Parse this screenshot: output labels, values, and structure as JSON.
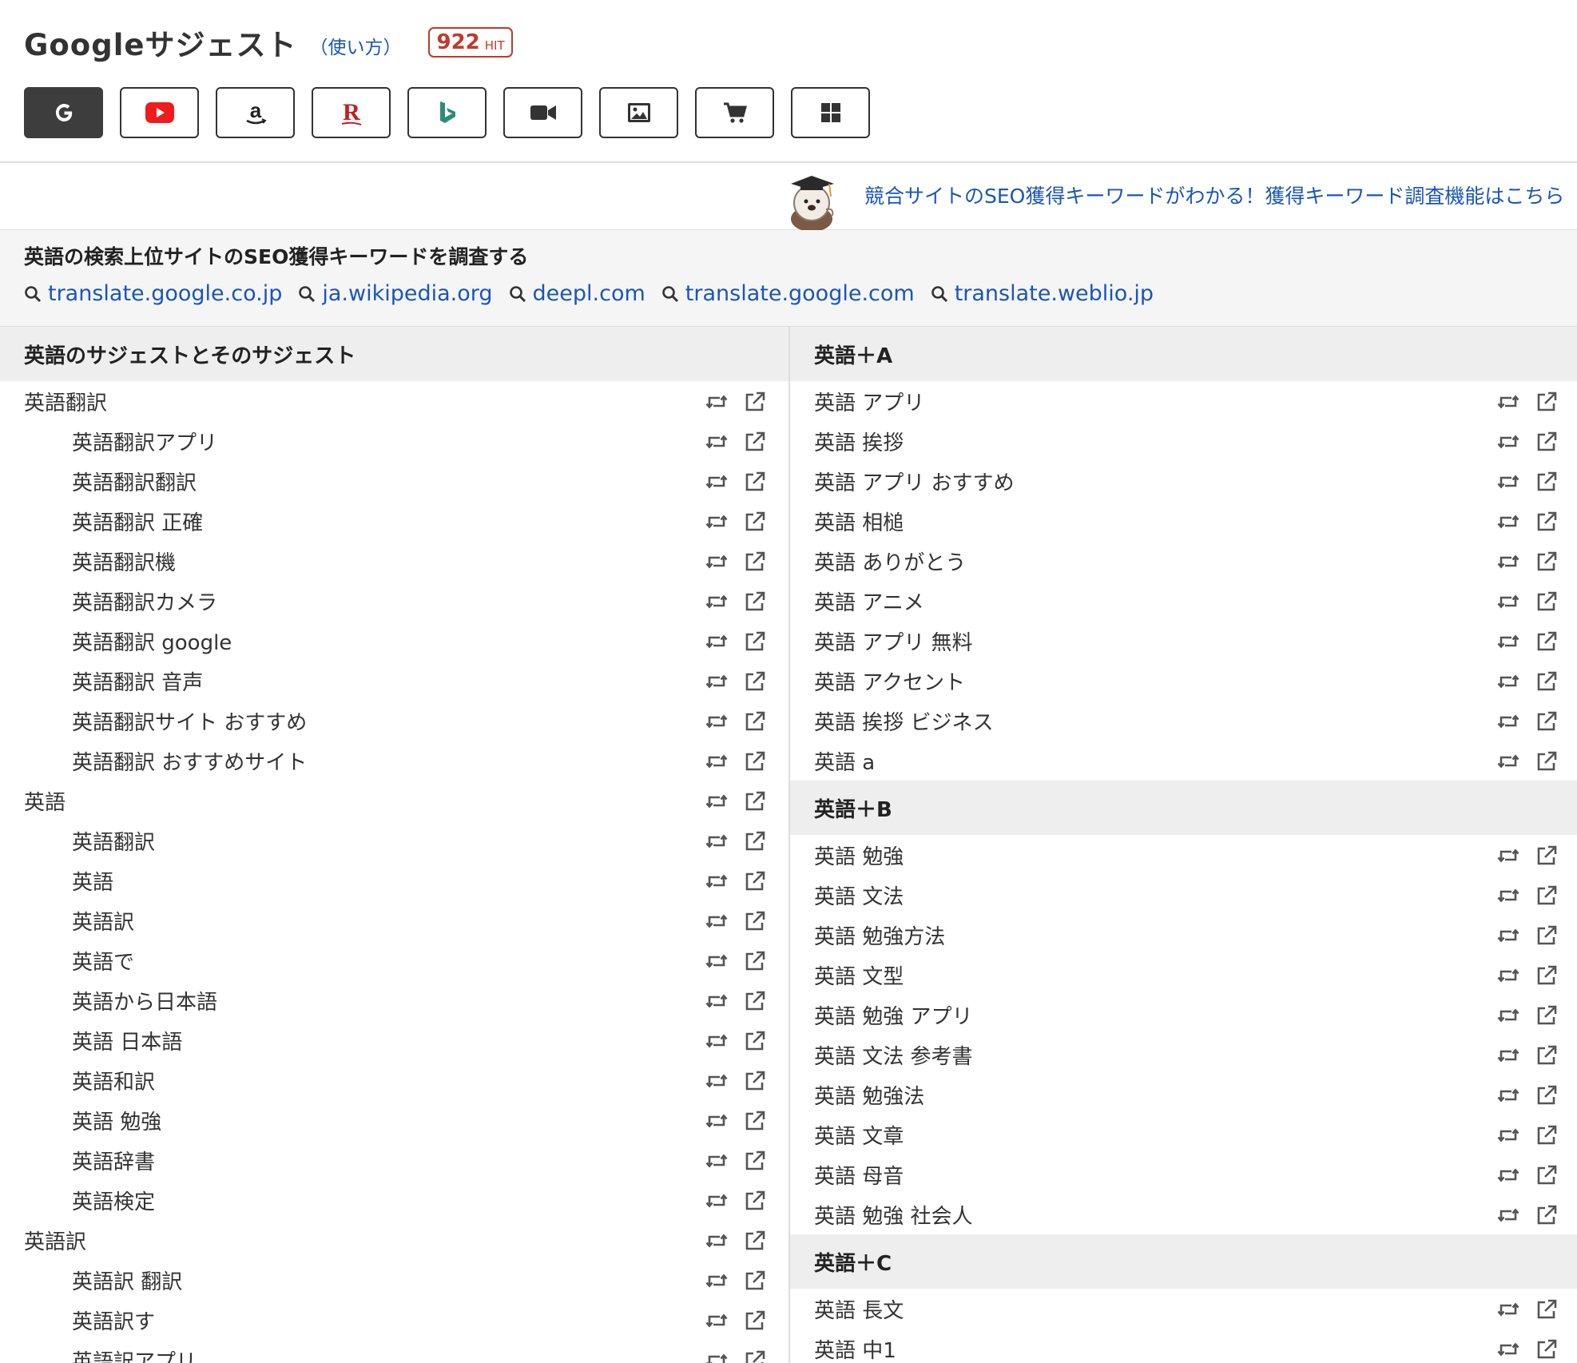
{
  "header": {
    "title": "Googleサジェスト",
    "howto": "（使い方）",
    "hit_count": "922",
    "hit_label": "HIT",
    "engines": [
      "google-icon",
      "youtube-icon",
      "amazon-icon",
      "rakuten-icon",
      "bing-icon",
      "video-icon",
      "image-icon",
      "cart-icon",
      "windows-icon"
    ],
    "active_engine": "google-icon"
  },
  "promo": {
    "text": "競合サイトのSEO獲得キーワードがわかる！獲得キーワード調査機能はこちら"
  },
  "seo": {
    "title": "英語の検索上位サイトのSEO獲得キーワードを調査する",
    "sites": [
      "translate.google.co.jp",
      "ja.wikipedia.org",
      "deepl.com",
      "translate.google.com",
      "translate.weblio.jp"
    ]
  },
  "left": {
    "header": "英語のサジェストとそのサジェスト",
    "rows": [
      {
        "text": "英語翻訳",
        "level": "parent"
      },
      {
        "text": "英語翻訳アプリ",
        "level": "child"
      },
      {
        "text": "英語翻訳翻訳",
        "level": "child"
      },
      {
        "text": "英語翻訳 正確",
        "level": "child"
      },
      {
        "text": "英語翻訳機",
        "level": "child"
      },
      {
        "text": "英語翻訳カメラ",
        "level": "child"
      },
      {
        "text": "英語翻訳 google",
        "level": "child"
      },
      {
        "text": "英語翻訳 音声",
        "level": "child"
      },
      {
        "text": "英語翻訳サイト おすすめ",
        "level": "child"
      },
      {
        "text": "英語翻訳 おすすめサイト",
        "level": "child"
      },
      {
        "text": "英語",
        "level": "parent"
      },
      {
        "text": "英語翻訳",
        "level": "child"
      },
      {
        "text": "英語",
        "level": "child"
      },
      {
        "text": "英語訳",
        "level": "child"
      },
      {
        "text": "英語で",
        "level": "child"
      },
      {
        "text": "英語から日本語",
        "level": "child"
      },
      {
        "text": "英語 日本語",
        "level": "child"
      },
      {
        "text": "英語和訳",
        "level": "child"
      },
      {
        "text": "英語 勉強",
        "level": "child"
      },
      {
        "text": "英語辞書",
        "level": "child"
      },
      {
        "text": "英語検定",
        "level": "child"
      },
      {
        "text": "英語訳",
        "level": "parent"
      },
      {
        "text": "英語訳 翻訳",
        "level": "child"
      },
      {
        "text": "英語訳す",
        "level": "child"
      },
      {
        "text": "英語訳アプリ",
        "level": "child"
      }
    ]
  },
  "right": {
    "sections": [
      {
        "header": "英語＋A",
        "rows": [
          "英語 アプリ",
          "英語 挨拶",
          "英語 アプリ おすすめ",
          "英語 相槌",
          "英語 ありがとう",
          "英語 アニメ",
          "英語 アプリ 無料",
          "英語 アクセント",
          "英語 挨拶 ビジネス",
          "英語 a"
        ]
      },
      {
        "header": "英語＋B",
        "rows": [
          "英語 勉強",
          "英語 文法",
          "英語 勉強方法",
          "英語 文型",
          "英語 勉強 アプリ",
          "英語 文法 参考書",
          "英語 勉強法",
          "英語 文章",
          "英語 母音",
          "英語 勉強 社会人"
        ]
      },
      {
        "header": "英語＋C",
        "rows": [
          "英語 長文",
          "英語 中1"
        ]
      }
    ]
  },
  "colors": {
    "link": "#1a56b8",
    "badge": "#c0392b",
    "active_button": "#3d3d3d",
    "section_bg": "#eeeeee"
  }
}
